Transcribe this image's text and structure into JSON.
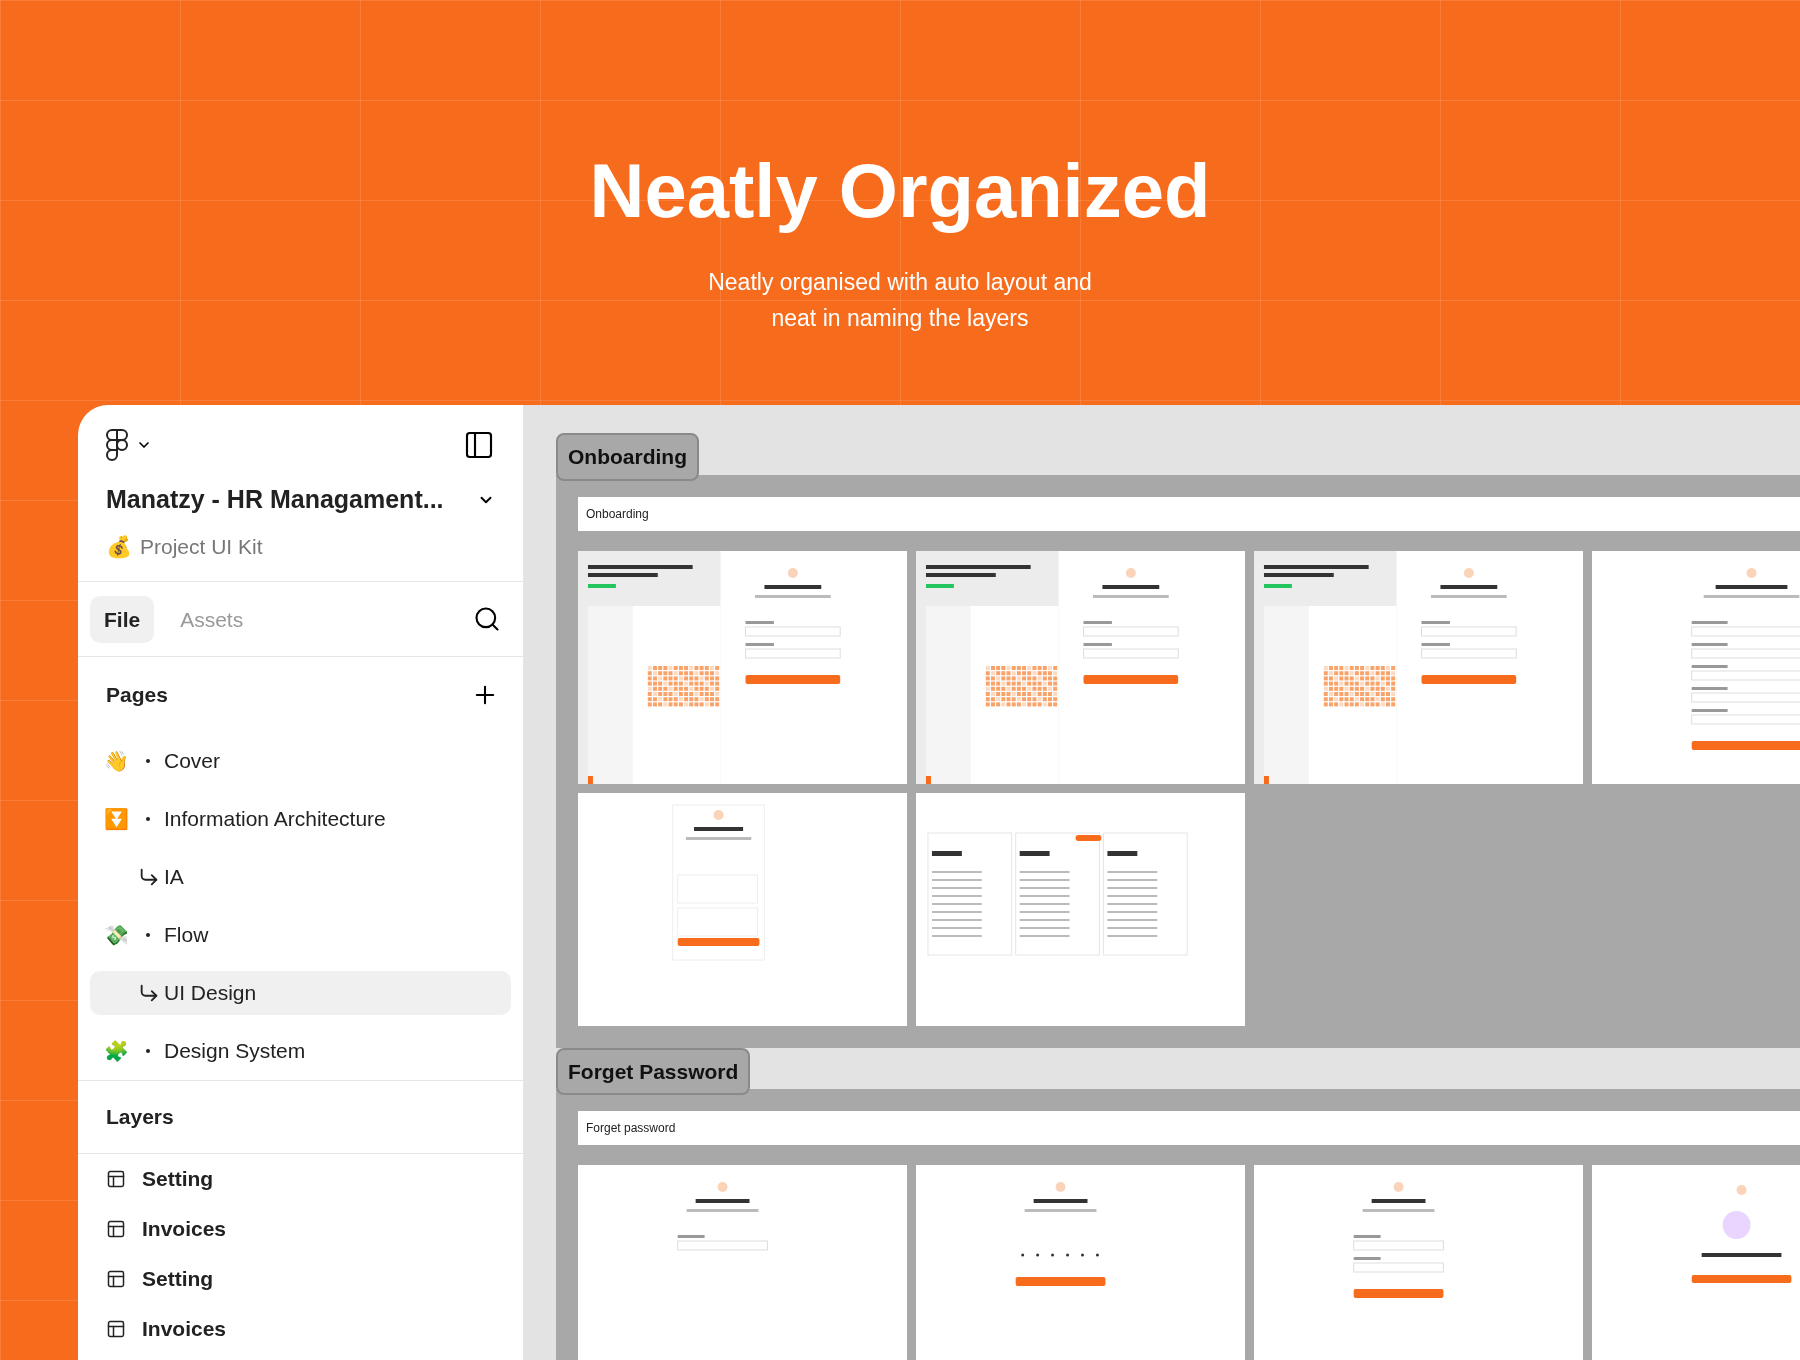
{
  "hero": {
    "title": "Neatly Organized",
    "subtitle_lines": [
      "Neatly organised with auto layout and",
      "neat in naming the layers"
    ]
  },
  "sidebar": {
    "project_name": "Manatzy - HR Managament...",
    "project_icon": "💰",
    "project_kind": "Project UI Kit",
    "tabs": [
      {
        "label": "File",
        "selected": true
      },
      {
        "label": "Assets",
        "selected": false
      }
    ],
    "pages_heading": "Pages",
    "pages": [
      {
        "kind": "page",
        "icon": "👋",
        "label": "Cover",
        "selected": false
      },
      {
        "kind": "page",
        "icon": "⏬",
        "label": "Information Architecture",
        "selected": false
      },
      {
        "kind": "subpage",
        "label": "IA",
        "selected": false
      },
      {
        "kind": "page",
        "icon": "💸",
        "label": "Flow",
        "selected": false
      },
      {
        "kind": "subpage",
        "label": "UI Design",
        "selected": true
      },
      {
        "kind": "page",
        "icon": "🧩",
        "label": "Design System",
        "selected": false
      }
    ],
    "layers_heading": "Layers",
    "layers": [
      "Setting",
      "Invoices",
      "Setting",
      "Invoices"
    ]
  },
  "canvas": {
    "sections": [
      {
        "label": "Onboarding",
        "frame_label": "Onboarding",
        "thumbnails": [
          {
            "kind": "login"
          },
          {
            "kind": "login"
          },
          {
            "kind": "login"
          },
          {
            "kind": "signup"
          },
          {
            "kind": "account-type"
          },
          {
            "kind": "pricing"
          }
        ]
      },
      {
        "label": "Forget Password",
        "frame_label": "Forget password",
        "thumbnails": [
          {
            "kind": "forgot"
          },
          {
            "kind": "verify"
          },
          {
            "kind": "new-password"
          },
          {
            "kind": "success"
          }
        ]
      }
    ]
  }
}
